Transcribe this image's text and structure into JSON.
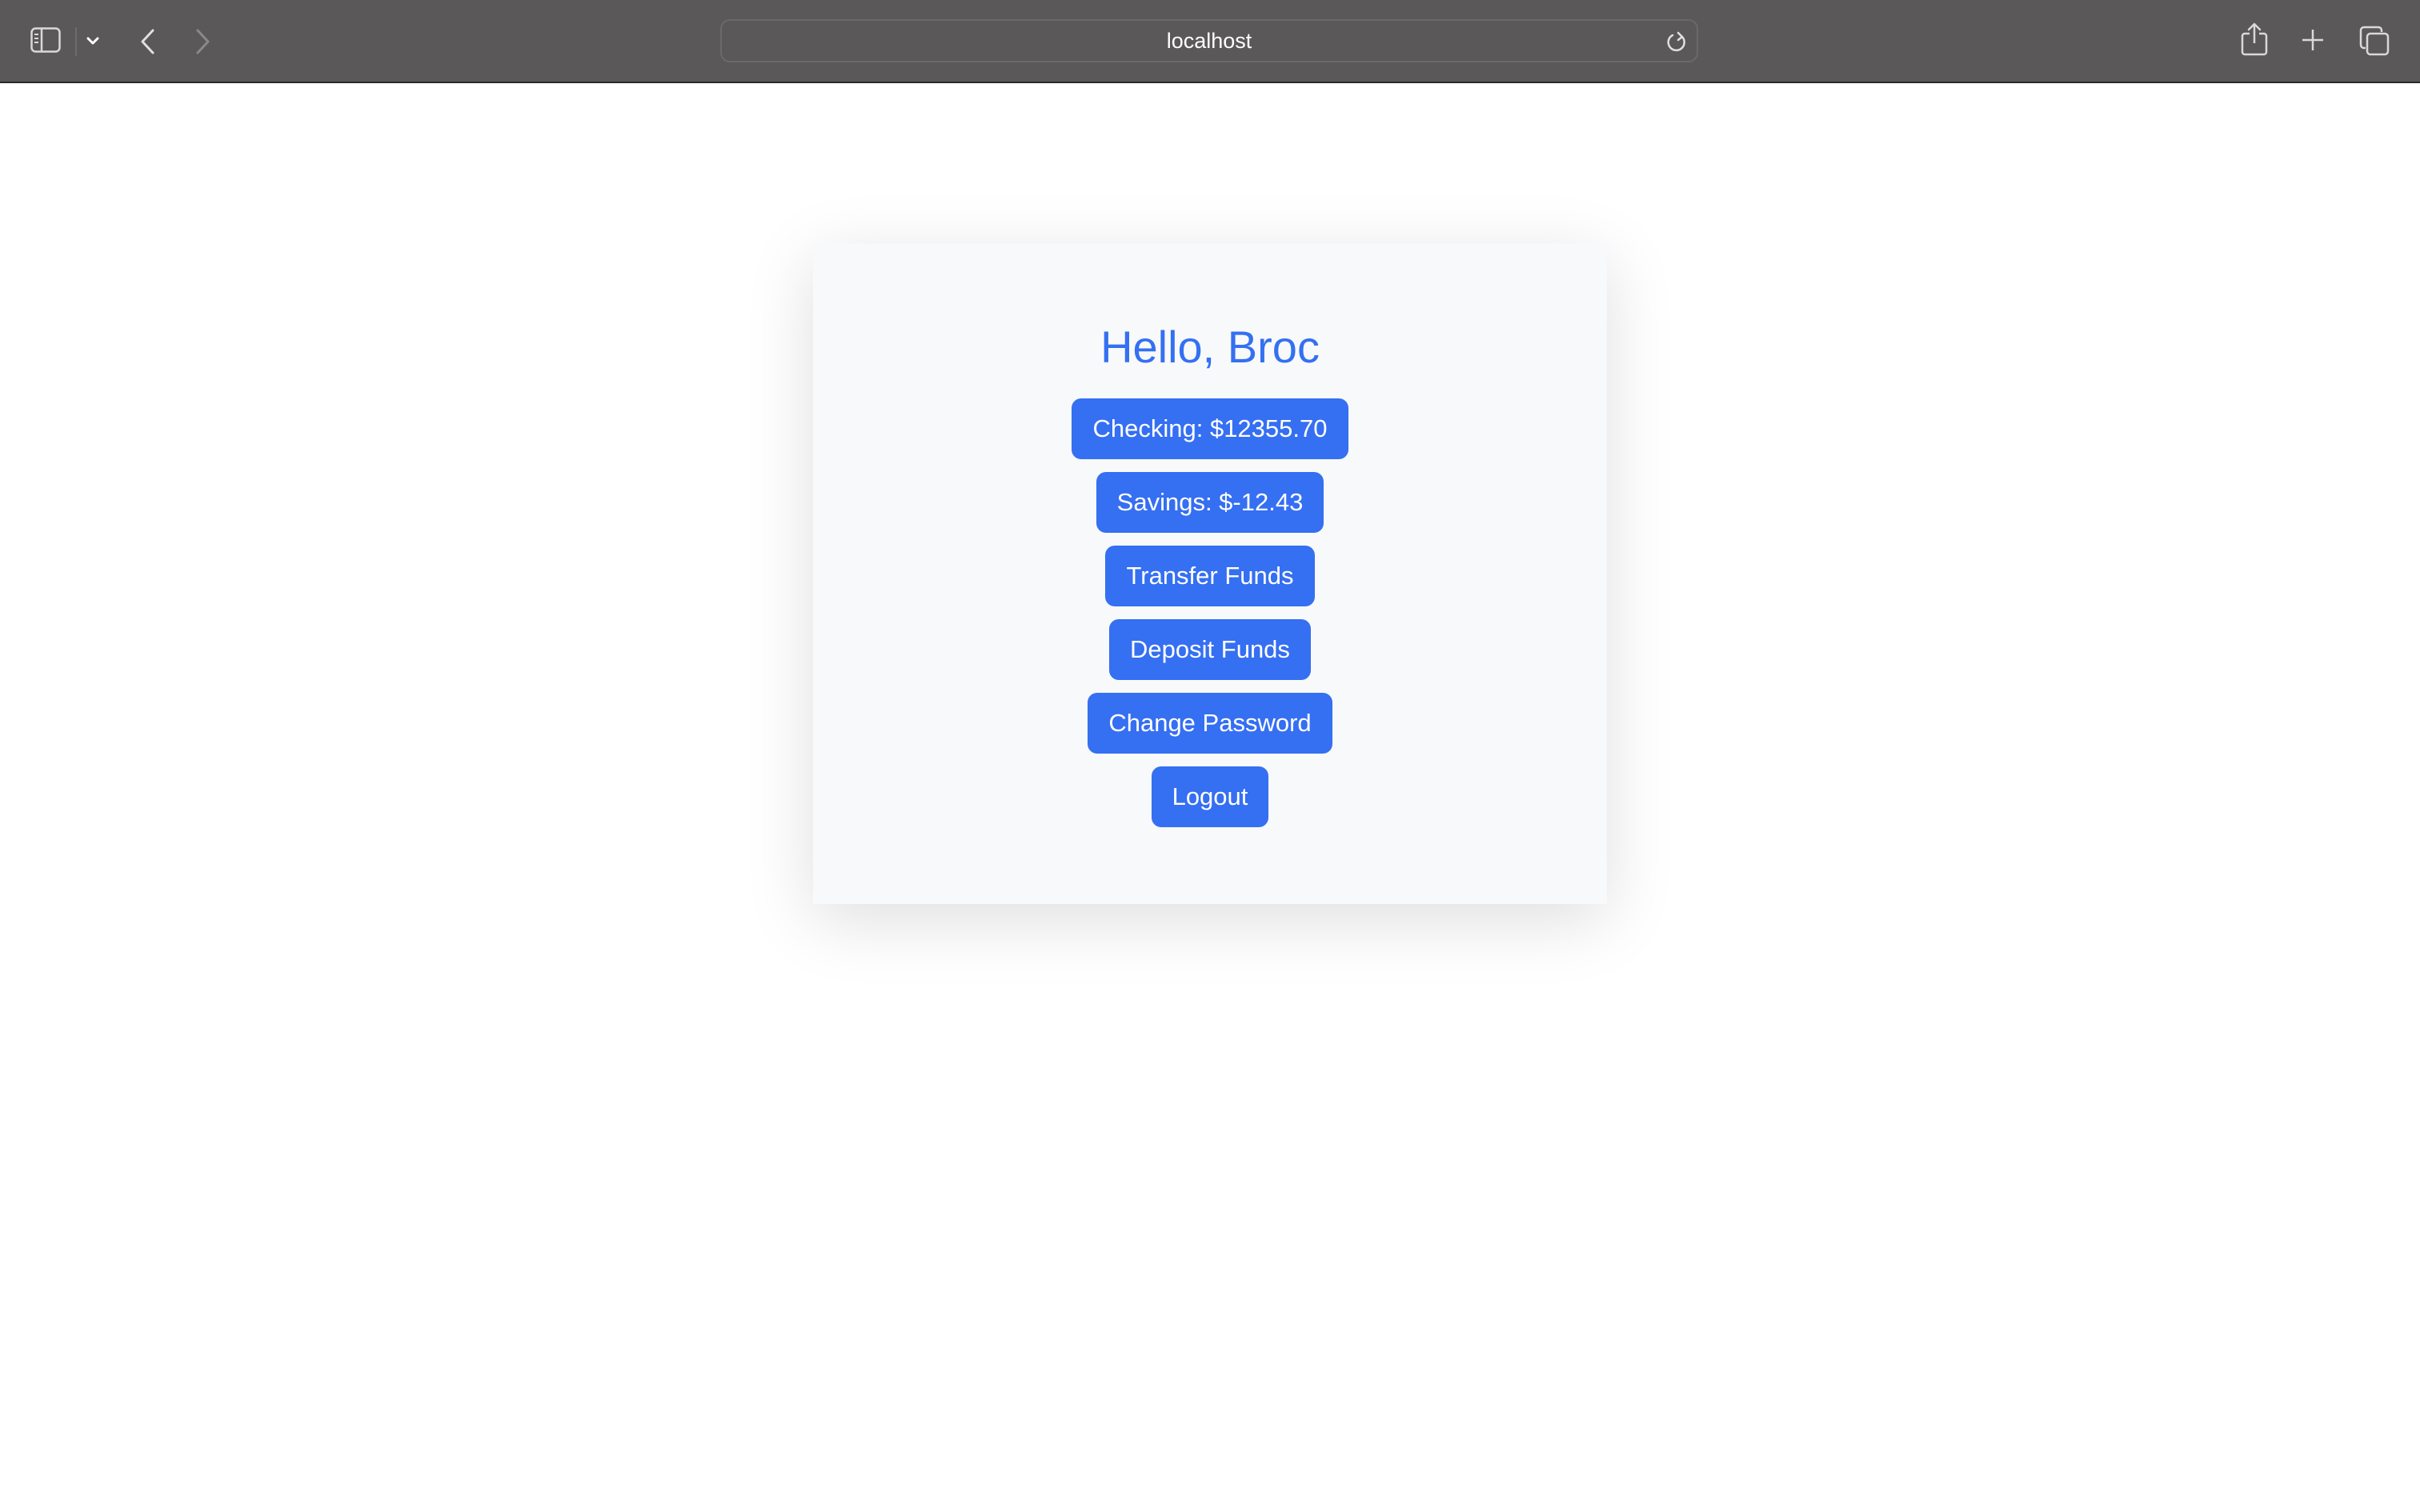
{
  "browser": {
    "url": "localhost",
    "icons": {
      "sidebar": "sidebar-icon",
      "sidebar_menu": "chevron-down-icon",
      "back": "chevron-left-icon",
      "forward": "chevron-right-icon",
      "reload": "reload-icon",
      "share": "share-icon",
      "new_tab": "plus-icon",
      "tab_overview": "tabs-icon"
    }
  },
  "page": {
    "greeting": "Hello, Broc",
    "accent_color": "#356ff2",
    "buttons": [
      {
        "id": "checking",
        "label": "Checking: $12355.70"
      },
      {
        "id": "savings",
        "label": "Savings: $-12.43"
      },
      {
        "id": "transfer",
        "label": "Transfer Funds"
      },
      {
        "id": "deposit",
        "label": "Deposit Funds"
      },
      {
        "id": "change-password",
        "label": "Change Password"
      },
      {
        "id": "logout",
        "label": "Logout"
      }
    ]
  }
}
